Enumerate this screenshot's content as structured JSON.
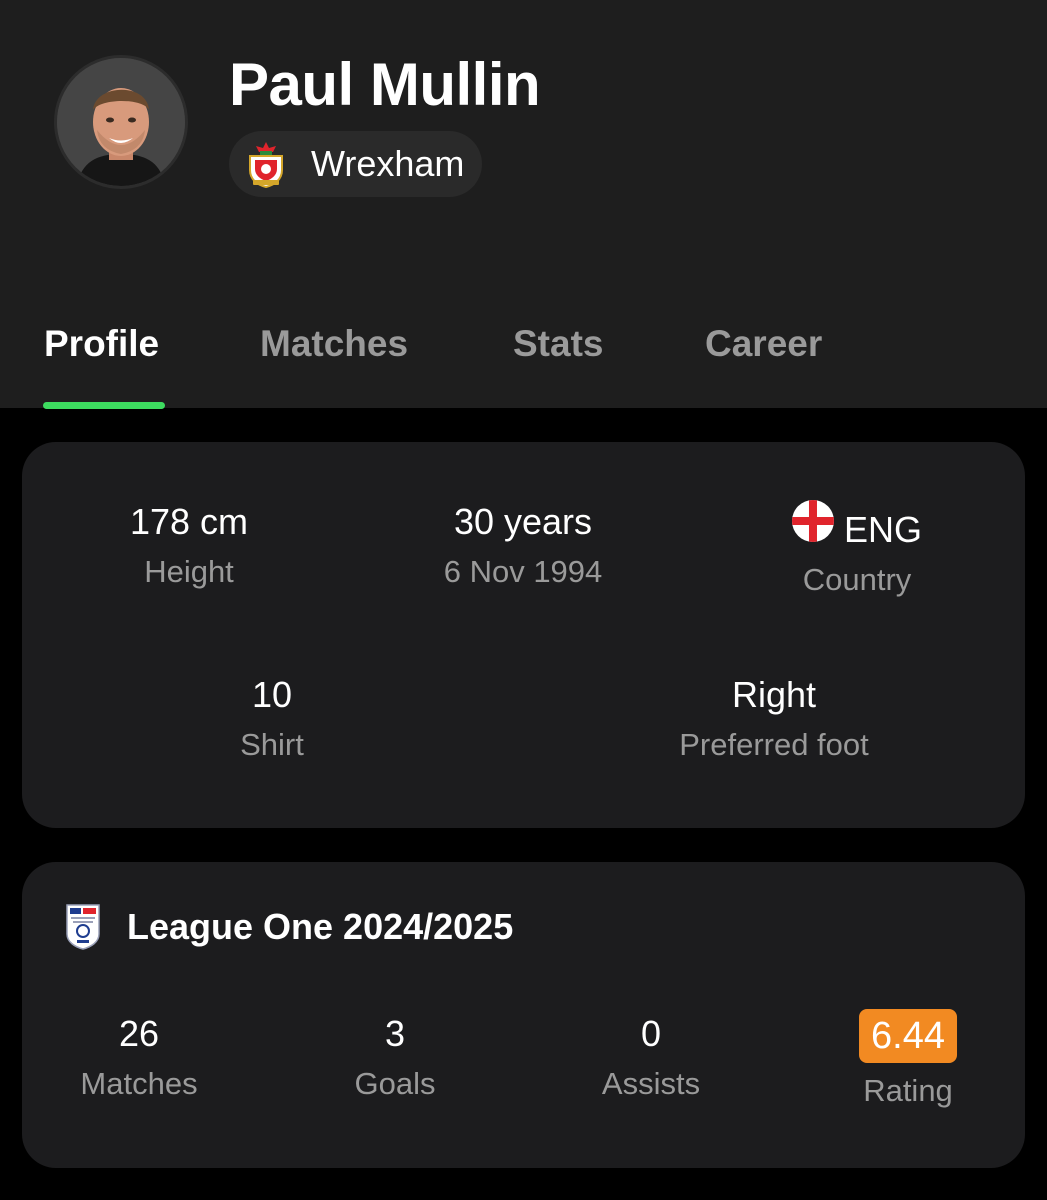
{
  "player": {
    "name": "Paul Mullin",
    "team": "Wrexham",
    "avatar_icon": "player-photo",
    "team_icon": "wrexham-crest-icon"
  },
  "tabs": [
    {
      "label": "Profile",
      "active": true
    },
    {
      "label": "Matches",
      "active": false
    },
    {
      "label": "Stats",
      "active": false
    },
    {
      "label": "Career",
      "active": false
    }
  ],
  "info": {
    "height": {
      "value": "178 cm",
      "label": "Height"
    },
    "age": {
      "value": "30 years",
      "label": "6 Nov 1994"
    },
    "country": {
      "value": "ENG",
      "label": "Country",
      "flag_icon": "england-flag-icon"
    },
    "shirt": {
      "value": "10",
      "label": "Shirt"
    },
    "foot": {
      "value": "Right",
      "label": "Preferred foot"
    }
  },
  "season": {
    "title": "League One 2024/2025",
    "logo_icon": "efl-league-one-logo",
    "stats": [
      {
        "value": "26",
        "label": "Matches"
      },
      {
        "value": "3",
        "label": "Goals"
      },
      {
        "value": "0",
        "label": "Assists"
      },
      {
        "value": "6.44",
        "label": "Rating"
      }
    ]
  },
  "colors": {
    "accent": "#3ddc5f",
    "rating_badge": "#f28a22",
    "header_bg": "#1e1e1e",
    "card_bg": "#1c1c1e"
  }
}
